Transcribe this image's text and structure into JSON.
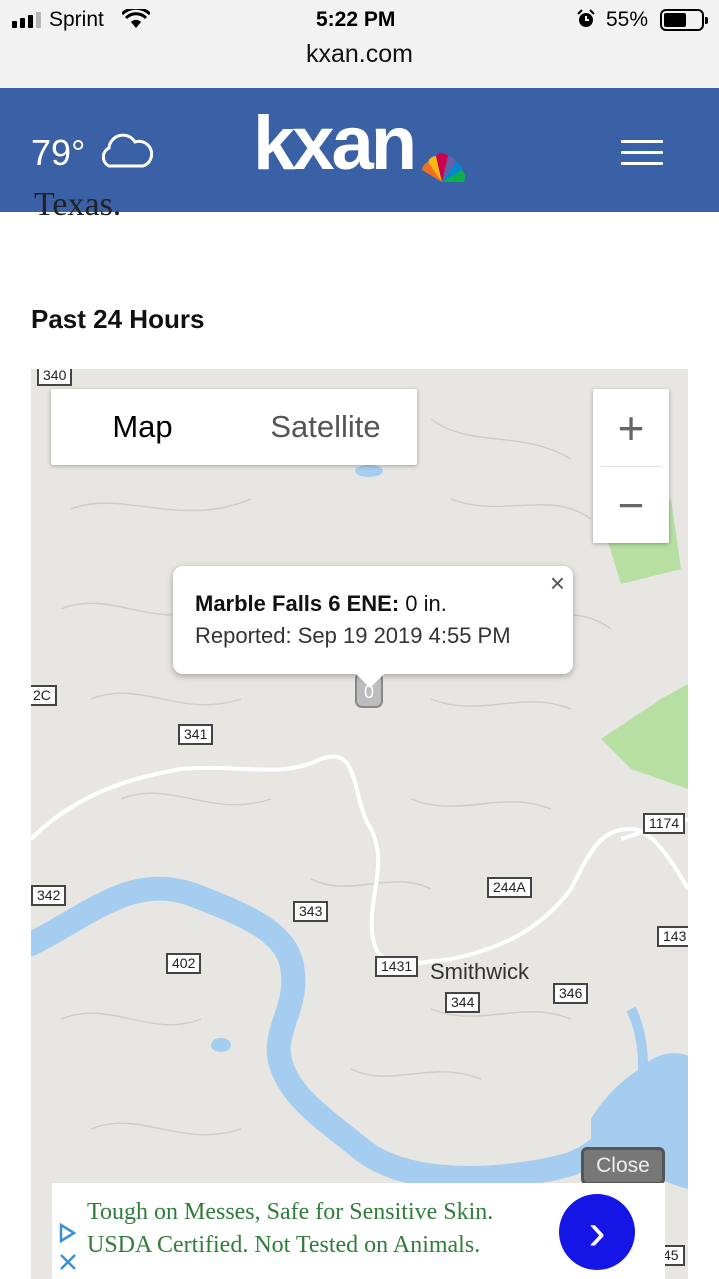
{
  "status_bar": {
    "carrier": "Sprint",
    "time": "5:22 PM",
    "battery": "55%",
    "battery_level": 0.55,
    "url": "kxan.com"
  },
  "header": {
    "temperature": "79°",
    "weather_icon": "cloud-icon",
    "logo": "kxan",
    "menu_icon": "hamburger-menu-icon",
    "color": "#3a60a6"
  },
  "article": {
    "partial_text": "Texas.",
    "section_title": "Past 24 Hours"
  },
  "map": {
    "map_type": {
      "map": "Map",
      "satellite": "Satellite",
      "selected": "Map"
    },
    "zoom_in": "+",
    "zoom_out": "−",
    "popup": {
      "location": "Marble Falls 6 ENE:",
      "value": " 0 in.",
      "reported": "Reported: Sep 19 2019 4:55 PM",
      "close": "×"
    },
    "shields": [
      "340",
      "2C",
      "341",
      "1174",
      "342",
      "244A",
      "143",
      "343",
      "402",
      "1431",
      "344",
      "346",
      "45"
    ],
    "town": "Smithwick",
    "close_button": "Close",
    "colors": {
      "land": "#e8e6e2",
      "water": "#a4cdf0",
      "park": "#b7dfa1",
      "road": "#ffffff"
    }
  },
  "ad": {
    "line1": "Tough on Messes, Safe for Sensitive Skin.",
    "line2": "USDA Certified. Not Tested on Animals.",
    "arrow": "›",
    "text_color": "#2f7d3a",
    "button_color": "#1515e6"
  }
}
